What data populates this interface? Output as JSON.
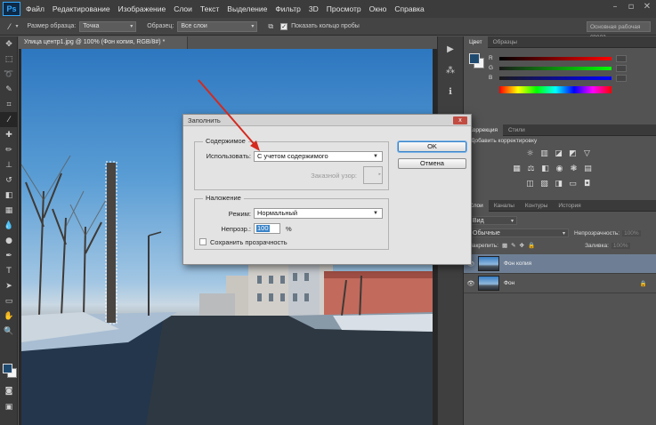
{
  "app": {
    "logo": "Ps"
  },
  "menu": [
    "Файл",
    "Редактирование",
    "Изображение",
    "Слои",
    "Текст",
    "Выделение",
    "Фильтр",
    "3D",
    "Просмотр",
    "Окно",
    "Справка"
  ],
  "options": {
    "sample_size_label": "Размер образца:",
    "sample_size_value": "Точка",
    "sample_label": "Образец:",
    "sample_value": "Все слои",
    "show_ring_label": "Показать кольцо пробы",
    "workspace": "Основная рабочая среда"
  },
  "document": {
    "tab_title": "Улица центр1.jpg @ 100% (Фон копия, RGB/8#) *"
  },
  "colors": {
    "foreground": "#1f4a70",
    "background": "#f4f4f4",
    "accent": "#3a84c9",
    "close": "#c24c42",
    "arrow": "#d42a1f"
  },
  "panels": {
    "color_tabs": [
      "Цвет",
      "Образцы"
    ],
    "sliders": [
      {
        "label": "R",
        "value": 0.25
      },
      {
        "label": "G",
        "value": 0.28
      },
      {
        "label": "B",
        "value": 0.3
      }
    ],
    "adjust_tabs": [
      "Коррекция",
      "Стили"
    ],
    "adjust_title": "Добавить корректировку",
    "layers_tabs": [
      "Слои",
      "Каналы",
      "Контуры",
      "История"
    ],
    "kind_value": "Вид",
    "blend_value": "Обычные",
    "opacity_label": "Непрозрачность:",
    "opacity_value": "100%",
    "lock_label": "Закрепить:",
    "fill_label": "Заливка:",
    "fill_value": "100%",
    "layers": [
      {
        "name": "Фон копия",
        "selected": true
      },
      {
        "name": "Фон",
        "selected": false
      }
    ]
  },
  "dialog": {
    "title": "Заполнить",
    "close": "x",
    "content_group": "Содержимое",
    "use_label": "Использовать:",
    "use_value": "С учетом содержимого",
    "pattern_label": "Заказной узор:",
    "blend_group": "Наложение",
    "mode_label": "Режим:",
    "mode_value": "Нормальный",
    "opacity_label": "Непрозр.:",
    "opacity_value": "100",
    "opacity_unit": "%",
    "preserve_label": "Сохранить прозрачность",
    "ok": "OK",
    "cancel": "Отмена"
  }
}
